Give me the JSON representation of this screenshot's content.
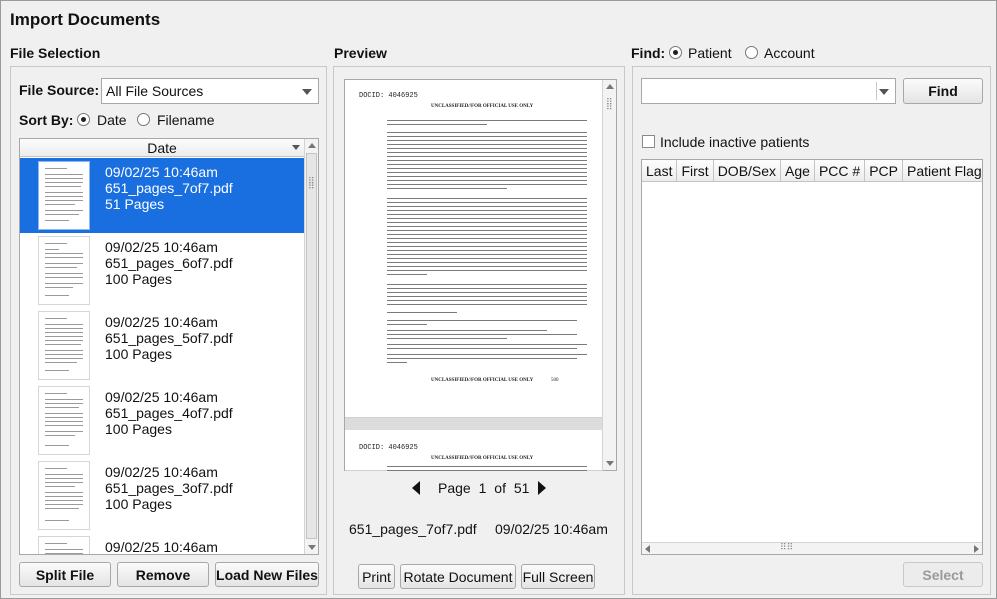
{
  "window": {
    "title": "Import Documents"
  },
  "file_selection": {
    "label": "File Selection",
    "source_label": "File Source:",
    "source_value": "All File Sources",
    "sort_label": "Sort By:",
    "sort_options": [
      {
        "label": "Date",
        "selected": true
      },
      {
        "label": "Filename",
        "selected": false
      }
    ],
    "column_header": "Date",
    "files": [
      {
        "date": "09/02/25 10:46am",
        "name": "651_pages_7of7.pdf",
        "pages": "51 Pages",
        "selected": true
      },
      {
        "date": "09/02/25 10:46am",
        "name": "651_pages_6of7.pdf",
        "pages": "100 Pages",
        "selected": false
      },
      {
        "date": "09/02/25 10:46am",
        "name": "651_pages_5of7.pdf",
        "pages": "100 Pages",
        "selected": false
      },
      {
        "date": "09/02/25 10:46am",
        "name": "651_pages_4of7.pdf",
        "pages": "100 Pages",
        "selected": false
      },
      {
        "date": "09/02/25 10:46am",
        "name": "651_pages_3of7.pdf",
        "pages": "100 Pages",
        "selected": false
      },
      {
        "date": "09/02/25 10:46am",
        "name": "",
        "pages": "",
        "selected": false
      }
    ],
    "buttons": {
      "split": "Split File",
      "remove": "Remove",
      "load": "Load New Files"
    }
  },
  "preview": {
    "label": "Preview",
    "doc_id": "DOCID: 4046925",
    "classification": "UNCLASSIFIED//FOR OFFICIAL USE ONLY",
    "page_number": "500",
    "page_word": "Page",
    "current_page": "1",
    "of_word": "of",
    "total_pages": "51",
    "file_name": "651_pages_7of7.pdf",
    "file_date": "09/02/25 10:46am",
    "buttons": {
      "print": "Print",
      "rotate": "Rotate Document",
      "fullscreen": "Full Screen"
    }
  },
  "find": {
    "label": "Find:",
    "options": [
      {
        "label": "Patient",
        "selected": true
      },
      {
        "label": "Account",
        "selected": false
      }
    ],
    "search_value": "",
    "find_button": "Find",
    "include_inactive_label": "Include inactive patients",
    "columns": [
      "Last",
      "First",
      "DOB/Sex",
      "Age",
      "PCC #",
      "PCP",
      "Patient Flags"
    ],
    "select_button": "Select"
  },
  "colors": {
    "selection": "#1a6fe0",
    "panel": "#f0f0f0",
    "border": "#a8a8a8"
  }
}
